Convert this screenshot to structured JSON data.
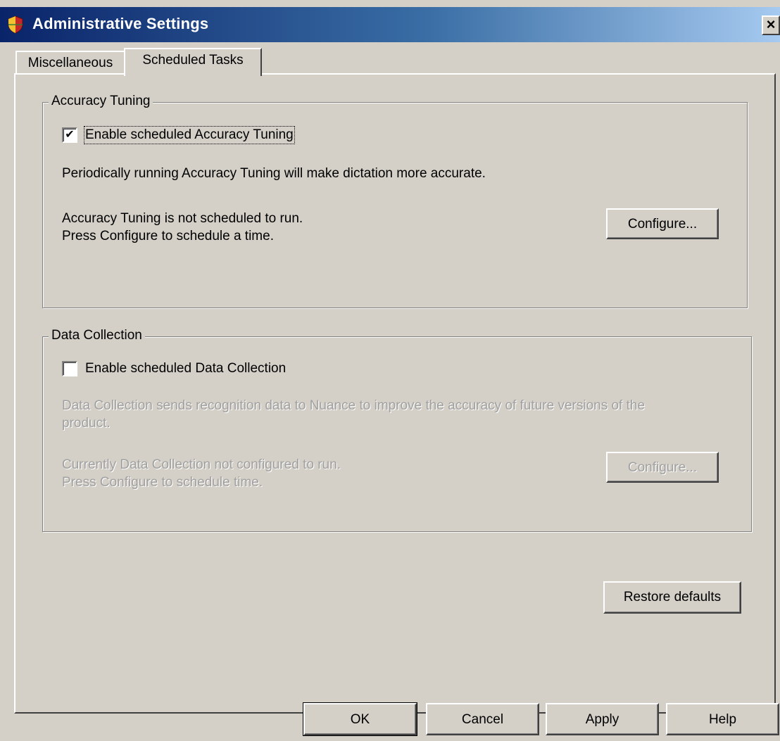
{
  "window": {
    "title": "Administrative Settings",
    "close_glyph": "×"
  },
  "tabs": [
    {
      "label": "Miscellaneous",
      "active": false
    },
    {
      "label": "Scheduled Tasks",
      "active": true
    }
  ],
  "accuracy_tuning": {
    "legend": "Accuracy Tuning",
    "checkbox_label": "Enable scheduled Accuracy Tuning",
    "checkbox_checked": true,
    "check_glyph": "✔",
    "description": "Periodically running Accuracy Tuning will make dictation more accurate.",
    "status_line1": "Accuracy Tuning is not scheduled to run.",
    "status_line2": "Press Configure to schedule a time.",
    "configure_button": "Configure...",
    "enabled": true
  },
  "data_collection": {
    "legend": "Data Collection",
    "checkbox_label": "Enable scheduled Data Collection",
    "checkbox_checked": false,
    "description_line1": "Data Collection sends recognition data to Nuance to improve the accuracy of future versions of the",
    "description_line2": "product.",
    "status_line1": "Currently Data Collection not configured to run.",
    "status_line2": "Press Configure to schedule time.",
    "configure_button": "Configure...",
    "enabled": false
  },
  "restore_defaults_button": "Restore defaults",
  "footer": {
    "ok": "OK",
    "cancel": "Cancel",
    "apply": "Apply",
    "help": "Help"
  },
  "icons": {
    "title_icon": "shield-icon",
    "close_icon": "close-icon"
  }
}
